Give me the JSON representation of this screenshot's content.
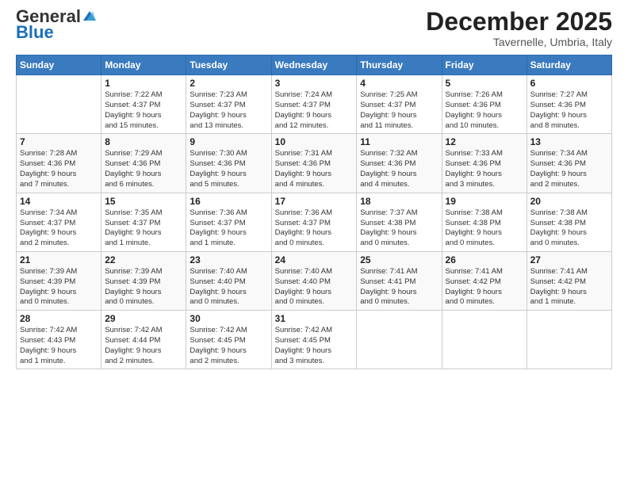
{
  "logo": {
    "general": "General",
    "blue": "Blue"
  },
  "title": "December 2025",
  "location": "Tavernelle, Umbria, Italy",
  "days_of_week": [
    "Sunday",
    "Monday",
    "Tuesday",
    "Wednesday",
    "Thursday",
    "Friday",
    "Saturday"
  ],
  "weeks": [
    [
      {
        "num": "",
        "info": ""
      },
      {
        "num": "1",
        "info": "Sunrise: 7:22 AM\nSunset: 4:37 PM\nDaylight: 9 hours\nand 15 minutes."
      },
      {
        "num": "2",
        "info": "Sunrise: 7:23 AM\nSunset: 4:37 PM\nDaylight: 9 hours\nand 13 minutes."
      },
      {
        "num": "3",
        "info": "Sunrise: 7:24 AM\nSunset: 4:37 PM\nDaylight: 9 hours\nand 12 minutes."
      },
      {
        "num": "4",
        "info": "Sunrise: 7:25 AM\nSunset: 4:37 PM\nDaylight: 9 hours\nand 11 minutes."
      },
      {
        "num": "5",
        "info": "Sunrise: 7:26 AM\nSunset: 4:36 PM\nDaylight: 9 hours\nand 10 minutes."
      },
      {
        "num": "6",
        "info": "Sunrise: 7:27 AM\nSunset: 4:36 PM\nDaylight: 9 hours\nand 8 minutes."
      }
    ],
    [
      {
        "num": "7",
        "info": "Sunrise: 7:28 AM\nSunset: 4:36 PM\nDaylight: 9 hours\nand 7 minutes."
      },
      {
        "num": "8",
        "info": "Sunrise: 7:29 AM\nSunset: 4:36 PM\nDaylight: 9 hours\nand 6 minutes."
      },
      {
        "num": "9",
        "info": "Sunrise: 7:30 AM\nSunset: 4:36 PM\nDaylight: 9 hours\nand 5 minutes."
      },
      {
        "num": "10",
        "info": "Sunrise: 7:31 AM\nSunset: 4:36 PM\nDaylight: 9 hours\nand 4 minutes."
      },
      {
        "num": "11",
        "info": "Sunrise: 7:32 AM\nSunset: 4:36 PM\nDaylight: 9 hours\nand 4 minutes."
      },
      {
        "num": "12",
        "info": "Sunrise: 7:33 AM\nSunset: 4:36 PM\nDaylight: 9 hours\nand 3 minutes."
      },
      {
        "num": "13",
        "info": "Sunrise: 7:34 AM\nSunset: 4:36 PM\nDaylight: 9 hours\nand 2 minutes."
      }
    ],
    [
      {
        "num": "14",
        "info": "Sunrise: 7:34 AM\nSunset: 4:37 PM\nDaylight: 9 hours\nand 2 minutes."
      },
      {
        "num": "15",
        "info": "Sunrise: 7:35 AM\nSunset: 4:37 PM\nDaylight: 9 hours\nand 1 minute."
      },
      {
        "num": "16",
        "info": "Sunrise: 7:36 AM\nSunset: 4:37 PM\nDaylight: 9 hours\nand 1 minute."
      },
      {
        "num": "17",
        "info": "Sunrise: 7:36 AM\nSunset: 4:37 PM\nDaylight: 9 hours\nand 0 minutes."
      },
      {
        "num": "18",
        "info": "Sunrise: 7:37 AM\nSunset: 4:38 PM\nDaylight: 9 hours\nand 0 minutes."
      },
      {
        "num": "19",
        "info": "Sunrise: 7:38 AM\nSunset: 4:38 PM\nDaylight: 9 hours\nand 0 minutes."
      },
      {
        "num": "20",
        "info": "Sunrise: 7:38 AM\nSunset: 4:38 PM\nDaylight: 9 hours\nand 0 minutes."
      }
    ],
    [
      {
        "num": "21",
        "info": "Sunrise: 7:39 AM\nSunset: 4:39 PM\nDaylight: 9 hours\nand 0 minutes."
      },
      {
        "num": "22",
        "info": "Sunrise: 7:39 AM\nSunset: 4:39 PM\nDaylight: 9 hours\nand 0 minutes."
      },
      {
        "num": "23",
        "info": "Sunrise: 7:40 AM\nSunset: 4:40 PM\nDaylight: 9 hours\nand 0 minutes."
      },
      {
        "num": "24",
        "info": "Sunrise: 7:40 AM\nSunset: 4:40 PM\nDaylight: 9 hours\nand 0 minutes."
      },
      {
        "num": "25",
        "info": "Sunrise: 7:41 AM\nSunset: 4:41 PM\nDaylight: 9 hours\nand 0 minutes."
      },
      {
        "num": "26",
        "info": "Sunrise: 7:41 AM\nSunset: 4:42 PM\nDaylight: 9 hours\nand 0 minutes."
      },
      {
        "num": "27",
        "info": "Sunrise: 7:41 AM\nSunset: 4:42 PM\nDaylight: 9 hours\nand 1 minute."
      }
    ],
    [
      {
        "num": "28",
        "info": "Sunrise: 7:42 AM\nSunset: 4:43 PM\nDaylight: 9 hours\nand 1 minute."
      },
      {
        "num": "29",
        "info": "Sunrise: 7:42 AM\nSunset: 4:44 PM\nDaylight: 9 hours\nand 2 minutes."
      },
      {
        "num": "30",
        "info": "Sunrise: 7:42 AM\nSunset: 4:45 PM\nDaylight: 9 hours\nand 2 minutes."
      },
      {
        "num": "31",
        "info": "Sunrise: 7:42 AM\nSunset: 4:45 PM\nDaylight: 9 hours\nand 3 minutes."
      },
      {
        "num": "",
        "info": ""
      },
      {
        "num": "",
        "info": ""
      },
      {
        "num": "",
        "info": ""
      }
    ]
  ]
}
